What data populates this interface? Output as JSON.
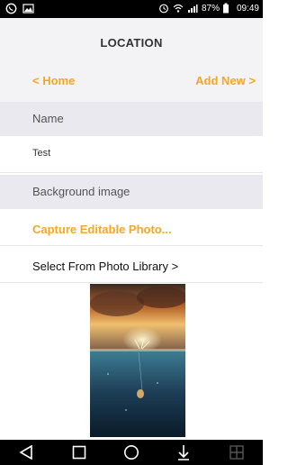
{
  "status": {
    "battery_percent": "87%",
    "time": "09:49",
    "left_icons": [
      "whatsapp-icon",
      "image-icon"
    ],
    "right_icons": [
      "alarm-icon",
      "wifi-icon",
      "signal-icon",
      "battery-icon"
    ]
  },
  "header": {
    "title": "LOCATION",
    "back_label": "< Home",
    "add_label": "Add New >"
  },
  "form": {
    "name_section": "Name",
    "name_value": "Test",
    "background_section": "Background image",
    "capture_label": "Capture Editable Photo...",
    "select_label": "Select From Photo Library >"
  },
  "navbar": {
    "buttons": [
      "back-triangle-icon",
      "recents-square-icon",
      "home-circle-icon",
      "download-arrow-icon",
      "grid-icon"
    ]
  },
  "colors": {
    "accent": "#f5a623",
    "section_bg": "#e9e9ef",
    "statusbar_bg": "#000000"
  }
}
